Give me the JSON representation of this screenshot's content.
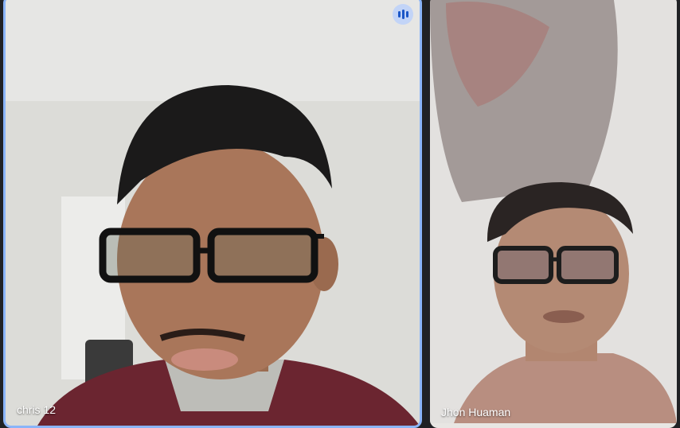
{
  "participants": [
    {
      "name": "chris 12",
      "speaking": true,
      "highlight_color": "#8ab4f8"
    },
    {
      "name": "Jhon Huaman",
      "speaking": false
    }
  ],
  "icons": {
    "speaking": "audio-level-icon"
  },
  "colors": {
    "background": "#202124",
    "speaking_border": "#8ab4f8",
    "name_text": "#ffffff"
  }
}
